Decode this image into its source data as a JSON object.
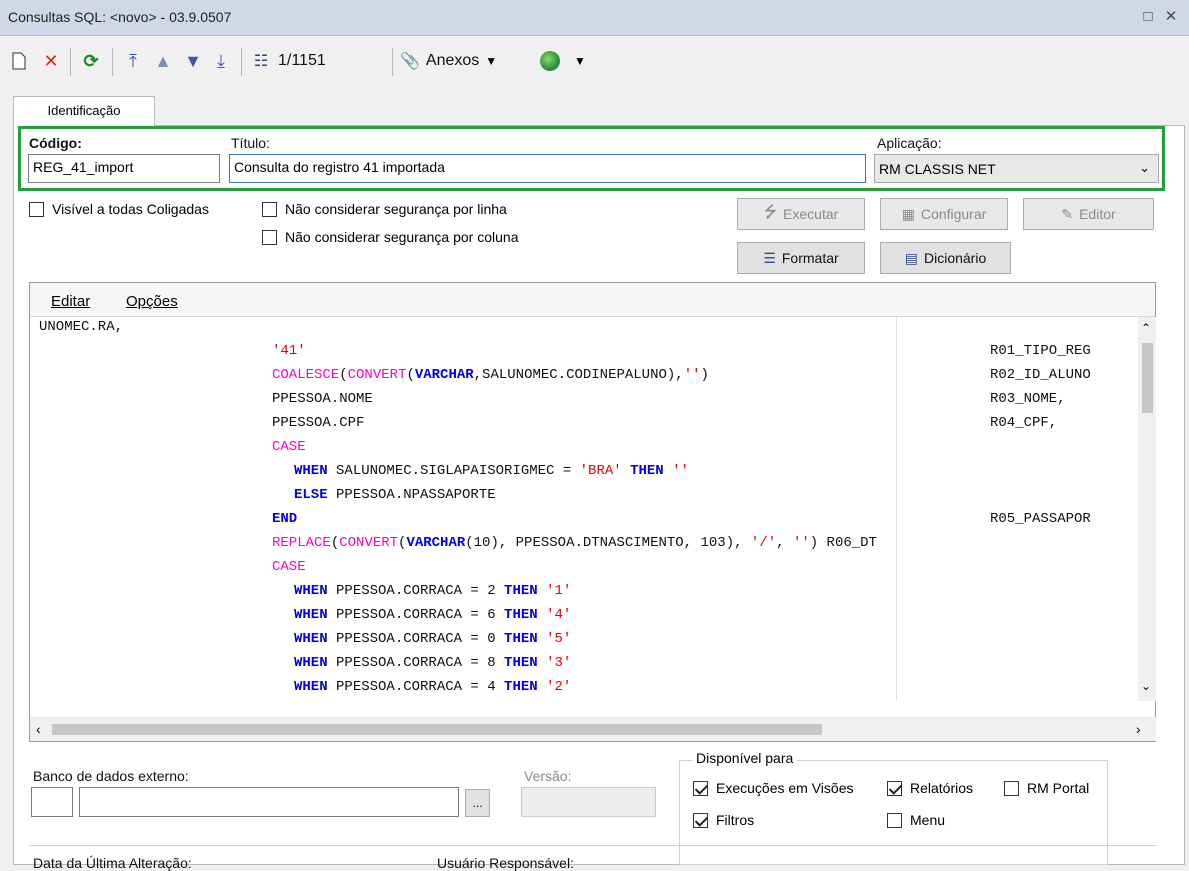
{
  "window": {
    "title": "Consultas SQL: <novo> - 03.9.0507"
  },
  "toolbar": {
    "record_counter": "1/1151",
    "anexos_label": "Anexos"
  },
  "tab": {
    "label": "Identificação"
  },
  "form": {
    "codigo_label": "Código:",
    "codigo_value": "REG_41_import",
    "titulo_label": "Título:",
    "titulo_value": "Consulta do registro 41 importada",
    "aplicacao_label": "Aplicação:",
    "aplicacao_value": "RM CLASSIS NET",
    "visivel_label": "Visível a todas Coligadas",
    "seg_linha_label": "Não considerar segurança por linha",
    "seg_coluna_label": "Não considerar segurança por coluna"
  },
  "buttons": {
    "executar": "Executar",
    "configurar": "Configurar",
    "editor": "Editor",
    "formatar": "Formatar",
    "dicionario": "Dicionário"
  },
  "editor_menu": {
    "editar": "Editar",
    "opcoes": "Opções"
  },
  "code_lines": [
    "UNOMEC.RA,",
    "'41'",
    "R01_TIPO_REG",
    "COALESCE",
    "(",
    "CONVERT",
    "(",
    "VARCHAR",
    ",SALUNOMEC.CODINEPALUNO),",
    "''",
    ")",
    "R02_ID_ALUNO",
    "PPESSOA.NOME",
    "R03_NOME,",
    "PPESSOA.CPF",
    "R04_CPF,",
    "CASE",
    "WHEN",
    " SALUNOMEC.SIGLAPAISORIGMEC = ",
    "'BRA'",
    " THEN ",
    "''",
    "ELSE",
    " PPESSOA.NPASSAPORTE",
    "END",
    "R05_PASSAPOR",
    "REPLACE",
    "(",
    "CONVERT",
    "(",
    "VARCHAR",
    "(10), PPESSOA.DTNASCIMENTO, 103), ",
    "'/'",
    ", ",
    "''",
    ") R06_DT",
    "CASE",
    "WHEN",
    " PPESSOA.CORRACA = 2 ",
    "THEN",
    " ",
    "'1'",
    "WHEN",
    " PPESSOA.CORRACA = 6 ",
    "THEN",
    " ",
    "'4'",
    "WHEN",
    " PPESSOA.CORRACA = 0 ",
    "THEN",
    " ",
    "'5'",
    "WHEN",
    " PPESSOA.CORRACA = 8 ",
    "THEN",
    " ",
    "'3'",
    "WHEN",
    " PPESSOA.CORRACA = 4 ",
    "THEN",
    " ",
    "'2'"
  ],
  "bottom": {
    "banco_label": "Banco de dados externo:",
    "versao_label": "Versão:",
    "browse_label": "...",
    "disponivel_title": "Disponível para",
    "exec_visoes": "Execuções em Visões",
    "relatorios": "Relatórios",
    "rm_portal": "RM Portal",
    "filtros": "Filtros",
    "menu": "Menu",
    "data_alteracao": "Data da Última Alteração:",
    "usuario": "Usuário Responsável:"
  }
}
